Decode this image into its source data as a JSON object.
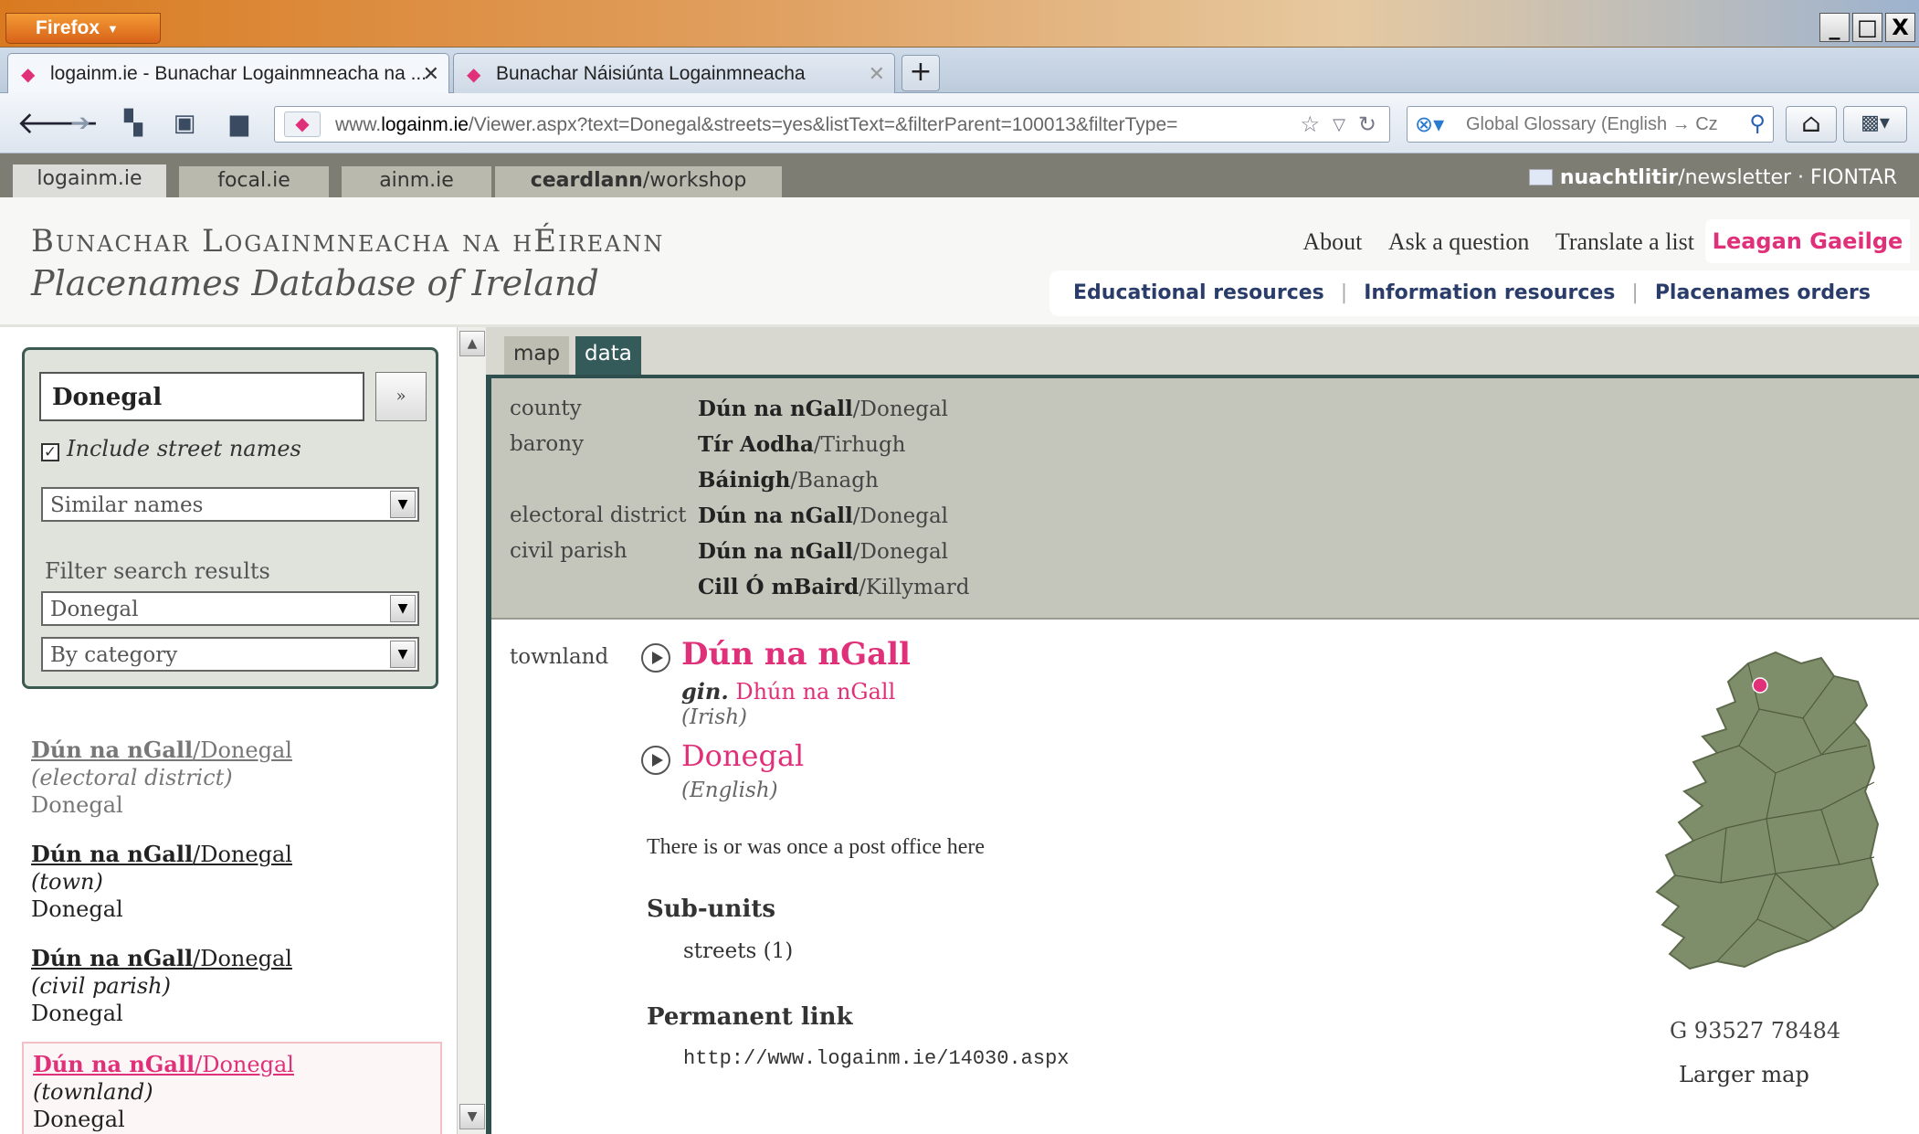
{
  "browser": {
    "menu_button": "Firefox",
    "window_controls": [
      "_",
      "□",
      "X"
    ],
    "tabs": [
      {
        "title": "logainm.ie - Bunachar Logainmneacha na ..."
      },
      {
        "title": "Bunachar Náisiúnta Logainmneacha"
      }
    ],
    "url_host": "www.logainm.ie",
    "url_domain": "logainm.ie",
    "url_path": "/Viewer.aspx?text=Donegal&streets=yes&listText=&filterParent=100013&filterType=",
    "search_text": "Global Glossary (English → Cz"
  },
  "site_tabs": [
    "logainm.ie",
    "focal.ie",
    "ainm.ie"
  ],
  "workshop_tab": {
    "bold": "ceardlann",
    "rest": "/workshop"
  },
  "newsletter": {
    "bold": "nuachtlitir",
    "rest": "/newsletter",
    "org": " · FIONTAR"
  },
  "header": {
    "title": "Bunachar Logainmneacha na hÉireann",
    "subtitle": "Placenames Database of Ireland",
    "links": [
      "About",
      "Ask a question",
      "Translate a list"
    ],
    "language_link": "Leagan Gaeilge",
    "resources": [
      "Educational resources",
      "Information resources",
      "Placenames orders"
    ]
  },
  "search": {
    "query": "Donegal",
    "go_label": "»",
    "include_streets_label": "Include street names",
    "include_streets_checked": true,
    "match_mode": "Similar names",
    "filter_label": "Filter search results",
    "filter_place": "Donegal",
    "filter_category": "By category"
  },
  "results": [
    {
      "irish": "Dún na nGall",
      "english": "/Donegal",
      "category": "(electoral district)",
      "county": "Donegal"
    },
    {
      "irish": "Dún na nGall",
      "english": "/Donegal",
      "category": "(town)",
      "county": "Donegal"
    },
    {
      "irish": "Dún na nGall",
      "english": "/Donegal",
      "category": "(civil parish)",
      "county": "Donegal"
    },
    {
      "irish": "Dún na nGall",
      "english": "/Donegal",
      "category": "(townland)",
      "county": "Donegal"
    }
  ],
  "view_tabs": {
    "map": "map",
    "data": "data"
  },
  "hierarchy": [
    {
      "label": "county",
      "irish": "Dún na nGall",
      "english": "/Donegal"
    },
    {
      "label": "barony",
      "irish": "Tír Aodha",
      "english": "/Tirhugh"
    },
    {
      "label": "",
      "irish": "Báinigh",
      "english": "/Banagh"
    },
    {
      "label": "electoral district",
      "irish": "Dún na nGall",
      "english": "/Donegal"
    },
    {
      "label": "civil parish",
      "irish": "Dún na nGall",
      "english": "/Donegal"
    },
    {
      "label": "",
      "irish": "Cill Ó mBaird",
      "english": "/Killymard"
    }
  ],
  "entry": {
    "type_label": "townland",
    "irish_name": "Dún na nGall",
    "genitive_label": "gin.",
    "genitive": " Dhún na nGall",
    "irish_lang": "(Irish)",
    "english_name": "Donegal",
    "english_lang": "(English)",
    "note": "There is or was once a post office here",
    "subunits_heading": "Sub-units",
    "subunits_item": "streets (1)",
    "permalink_heading": "Permanent link",
    "permalink": "http://www.logainm.ie/14030.aspx",
    "grid_reference": "G 93527 78484",
    "larger_map": "Larger map"
  },
  "colors": {
    "accent": "#e0307a",
    "panel_dark": "#2f4f4f",
    "map_land": "#7f8e6a"
  }
}
